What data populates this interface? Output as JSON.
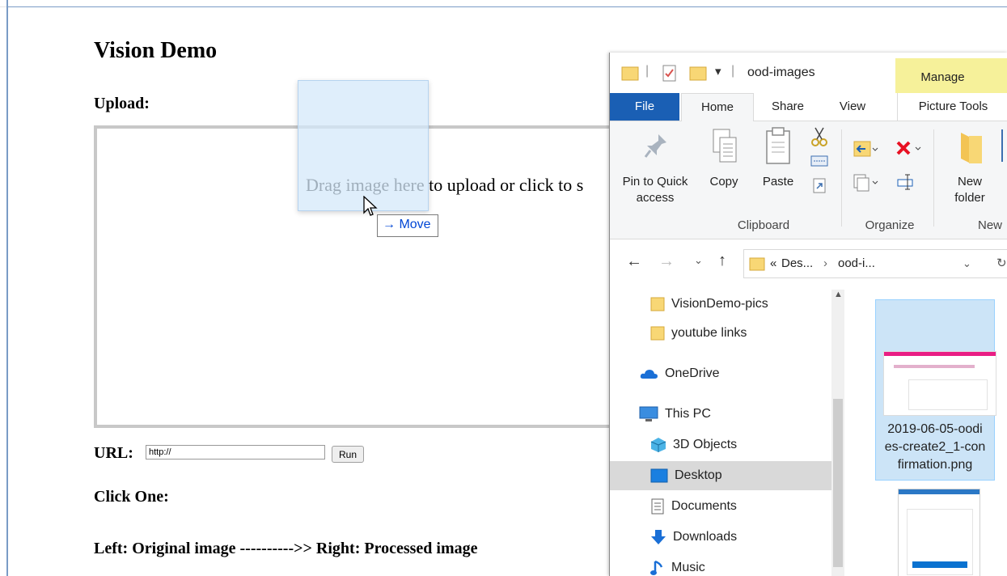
{
  "page": {
    "title": "Vision Demo",
    "upload_label": "Upload:",
    "drop_text": "Drag image here to upload or click to s",
    "url_label": "URL:",
    "url_value": "http://",
    "run_label": "Run",
    "click_one": "Click One:",
    "left_right": "Left: Original image ---------->> Right: Processed image"
  },
  "drag": {
    "tooltip": "Move",
    "tooltip_arrow": "→"
  },
  "explorer": {
    "title": "ood-images",
    "manage_tab": "Manage",
    "tabs": {
      "file": "File",
      "home": "Home",
      "share": "Share",
      "view": "View",
      "picture_tools": "Picture Tools"
    },
    "ribbon": {
      "pin_line1": "Pin to Quick",
      "pin_line2": "access",
      "copy": "Copy",
      "paste": "Paste",
      "new_line1": "New",
      "new_line2": "folder",
      "group_clipboard": "Clipboard",
      "group_organize": "Organize",
      "group_new": "New"
    },
    "address": {
      "part1": "Des...",
      "part2": "ood-i...",
      "prefix": "«",
      "sep": "›"
    },
    "nav": [
      "VisionDemo-pics",
      "youtube links",
      "OneDrive",
      "This PC",
      "3D Objects",
      "Desktop",
      "Documents",
      "Downloads",
      "Music"
    ],
    "selected_nav": "Desktop",
    "file": {
      "name_lines": [
        "2019-06-05-oodi",
        "es-create2_1-con",
        "firmation.png"
      ]
    },
    "colors": {
      "file_tab": "#1a5fb4",
      "manage": "#f6f19a",
      "selection": "#cce4f7"
    }
  }
}
